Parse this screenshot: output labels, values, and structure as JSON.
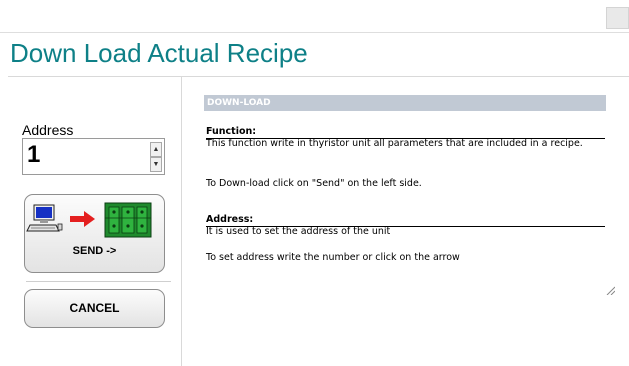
{
  "page": {
    "title": "Down Load Actual Recipe"
  },
  "address": {
    "label": "Address",
    "value": "1"
  },
  "buttons": {
    "send": "SEND ->",
    "cancel": "CANCEL"
  },
  "help": {
    "header": "DOWN-LOAD",
    "function_title": "Function:",
    "function_text": "This function write in thyristor unit all parameters that are included in a recipe.",
    "download_text": "To Down-load click on \"Send\" on the left side.",
    "address_title": "Address:",
    "address_text": "It is used to set the address of the unit",
    "address_hint": "To set address write the number or click on the arrow"
  },
  "colors": {
    "title": "#0e8087",
    "help_header_bg": "#c1c9d4"
  },
  "icons": [
    "computer-icon",
    "arrow-right-icon",
    "thyristor-unit-icon",
    "spin-up-icon",
    "spin-down-icon",
    "resize-grip-icon"
  ]
}
